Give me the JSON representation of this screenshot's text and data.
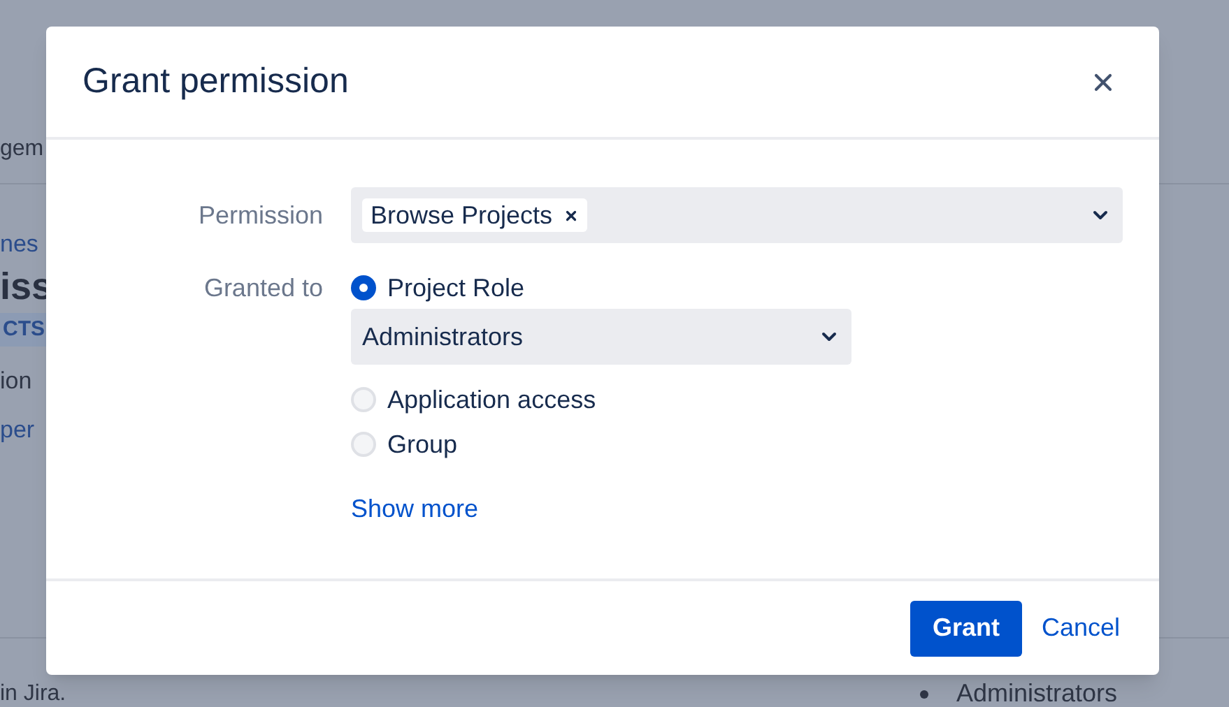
{
  "background": {
    "breadcrumb_fragment": "gem",
    "link_fragment": "nes",
    "heading_fragment": "iss",
    "tag_fragment": "CTS",
    "text_fragment": "ion",
    "link_fragment_2": "per",
    "footer_fragment": "in Jira.",
    "list_items": [
      "Administrators"
    ]
  },
  "dialog": {
    "title": "Grant permission",
    "permission": {
      "label": "Permission",
      "tags": [
        "Browse Projects"
      ]
    },
    "granted_to": {
      "label": "Granted to",
      "options": [
        {
          "label": "Project Role",
          "selected": true,
          "select_value": "Administrators"
        },
        {
          "label": "Application access",
          "selected": false
        },
        {
          "label": "Group",
          "selected": false
        }
      ]
    },
    "show_more": "Show more",
    "buttons": {
      "grant": "Grant",
      "cancel": "Cancel"
    }
  }
}
